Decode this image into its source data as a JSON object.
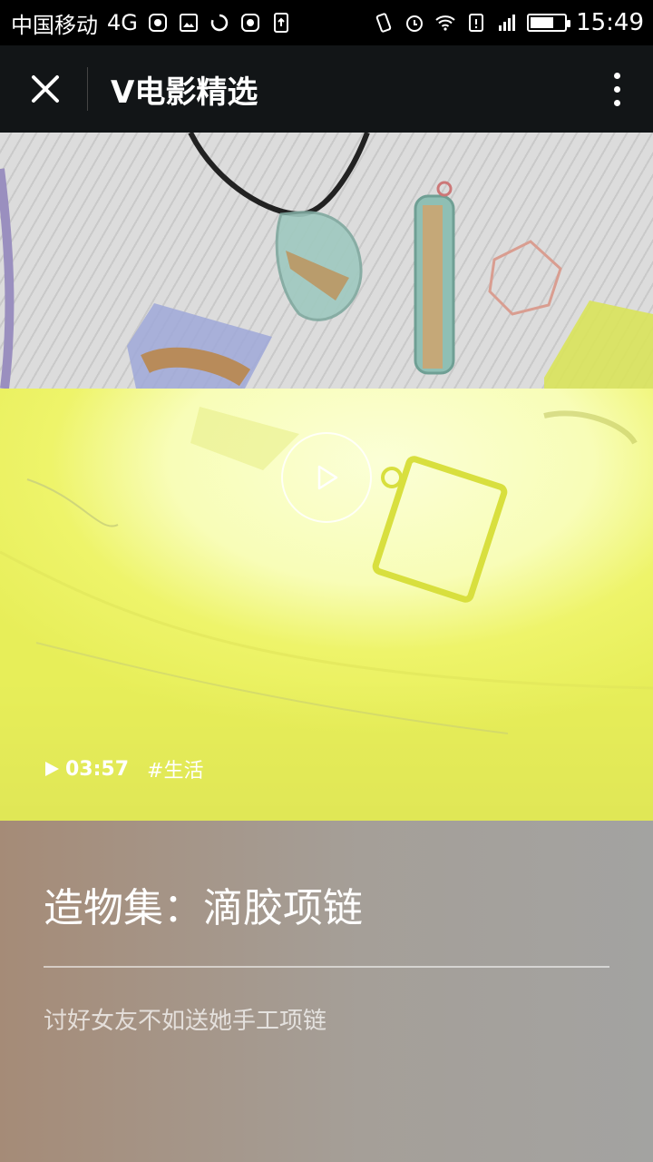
{
  "status_bar": {
    "carrier": "中国移动",
    "network": "4G",
    "time": "15:49",
    "battery_level": 0.7
  },
  "top_bar": {
    "title": "V电影精选"
  },
  "video": {
    "duration": "03:57",
    "tag": "#生活"
  },
  "info": {
    "headline": "造物集：滴胶项链",
    "subtitle": "讨好女友不如送她手工项链"
  },
  "colors": {
    "top_bar_bg": "#121517",
    "info_bg_left": "#a58b77",
    "info_bg_right": "#a3a3a1",
    "video_tint": "#eef46a"
  }
}
